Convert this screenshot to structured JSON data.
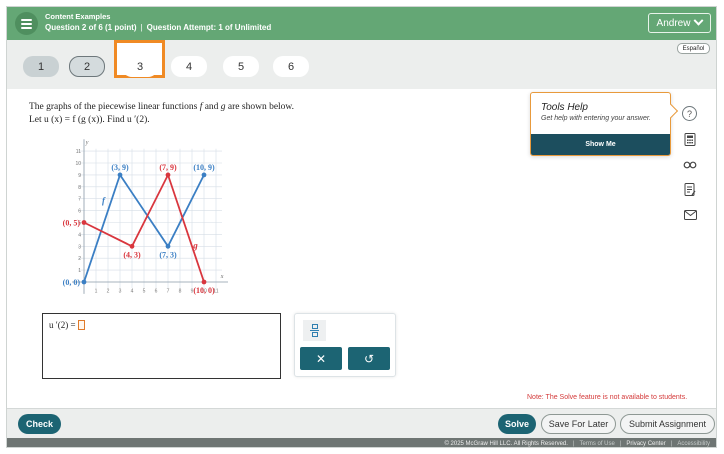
{
  "header": {
    "course": "Content Examples",
    "question_info": "Question 2 of 6 (1 point)",
    "separator": "|",
    "attempt_info": "Question Attempt: 1 of Unlimited",
    "user_name": "Andrew"
  },
  "nav": {
    "questions": [
      "1",
      "2",
      "3",
      "4",
      "5",
      "6"
    ],
    "language_toggle": "Español"
  },
  "question": {
    "line1_a": "The graphs of the piecewise linear functions ",
    "var_f": "f",
    "and": " and ",
    "var_g": "g",
    "line1_b": " are shown below.",
    "line2": "Let u (x) = f (g (x)).  Find u ′(2)."
  },
  "graph": {
    "f_label": "f",
    "g_label": "g",
    "x_axis_label": "x",
    "y_axis_label": "y",
    "f_points": [
      [
        0,
        0
      ],
      [
        3,
        9
      ],
      [
        7,
        3
      ],
      [
        10,
        9
      ]
    ],
    "g_points": [
      [
        0,
        5
      ],
      [
        4,
        3
      ],
      [
        7,
        9
      ],
      [
        10,
        0
      ]
    ],
    "f_color": "#3b7fc4",
    "g_color": "#d9363e",
    "point_labels": {
      "f0": "(0, 0)",
      "f1": "(3, 9)",
      "f2": "(7, 3)",
      "f3": "(10, 9)",
      "g0": "(0, 5)",
      "g1": "(4, 3)",
      "g2": "(7, 9)",
      "g3": "(10, 0)"
    },
    "x_ticks": [
      "1",
      "2",
      "3",
      "4",
      "5",
      "6",
      "7",
      "8",
      "9",
      "10",
      "11"
    ],
    "y_ticks": [
      "1",
      "2",
      "3",
      "4",
      "5",
      "6",
      "7",
      "8",
      "9",
      "10",
      "11"
    ],
    "x_range": [
      -1,
      12
    ],
    "y_range": [
      -1,
      12
    ]
  },
  "answer": {
    "expression": "u ′(2) ="
  },
  "keypad": {
    "clear_symbol": "✕",
    "undo_symbol": "↺"
  },
  "tools_help": {
    "title": "Tools Help",
    "description": "Get help with entering your answer.",
    "show_me": "Show Me"
  },
  "note": "Note: The Solve feature is not available to students.",
  "footer": {
    "check": "Check",
    "solve": "Solve",
    "save": "Save For Later",
    "submit": "Submit Assignment",
    "copyright": "© 2025 McGraw Hill LLC. All Rights Reserved.",
    "terms": "Terms of Use",
    "privacy": "Privacy Center",
    "accessibility": "Accessibility"
  },
  "icons": {
    "help": "?",
    "calculator": "calculator-icon",
    "glasses": "glasses-icon",
    "notes": "notes-icon",
    "mail": "mail-icon"
  }
}
